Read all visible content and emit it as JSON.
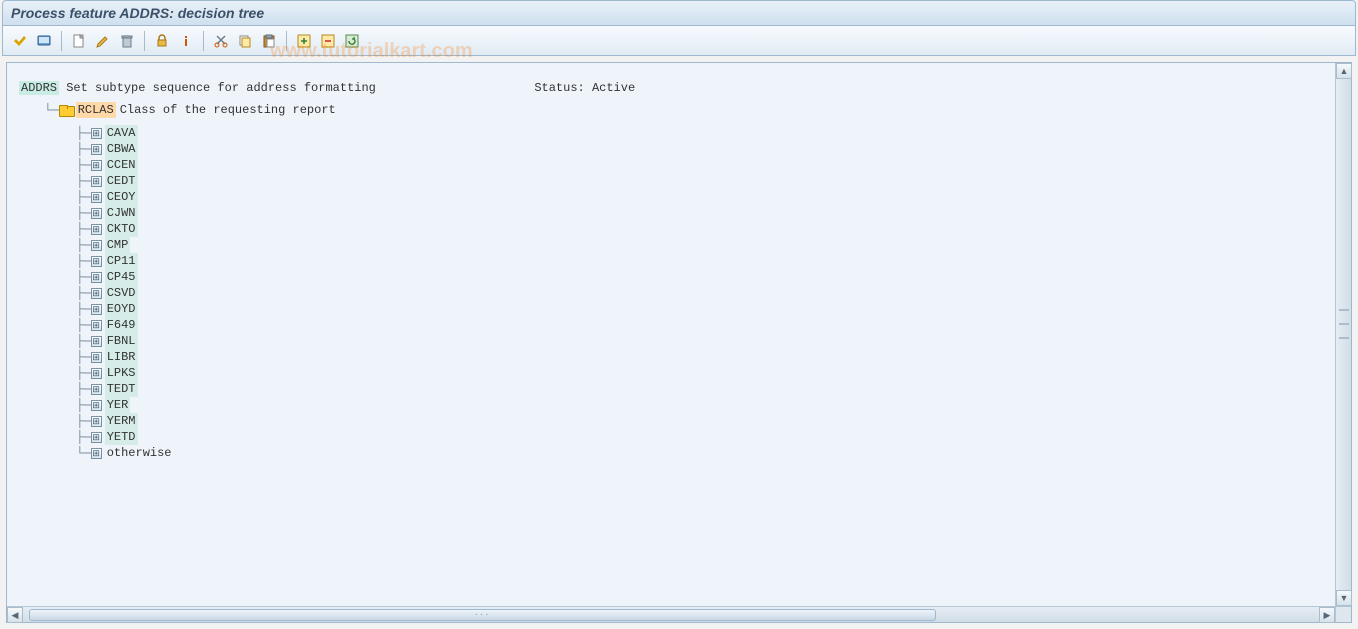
{
  "title": "Process feature ADDRS: decision tree",
  "watermark": "www.tutorialkart.com",
  "toolbar": {
    "icons": [
      "check-icon",
      "display-icon",
      "sep",
      "create-icon",
      "edit-icon",
      "delete-icon",
      "sep",
      "lock-icon",
      "info-icon",
      "sep",
      "cut-icon",
      "copy-icon",
      "paste-icon",
      "sep",
      "expand-icon",
      "collapse-icon",
      "refresh-icon"
    ]
  },
  "tree": {
    "root": {
      "code": "ADDRS",
      "desc": "Set subtype sequence for address formatting"
    },
    "status_label": "Status:",
    "status_value": "Active",
    "child": {
      "code": "RCLAS",
      "desc": "Class of the requesting report"
    },
    "leaves": [
      "CAVA",
      "CBWA",
      "CCEN",
      "CEDT",
      "CEOY",
      "CJWN",
      "CKTO",
      "CMP",
      "CP11",
      "CP45",
      "CSVD",
      "EOYD",
      "F649",
      "FBNL",
      "LIBR",
      "LPKS",
      "TEDT",
      "YER",
      "YERM",
      "YETD",
      "otherwise"
    ]
  }
}
